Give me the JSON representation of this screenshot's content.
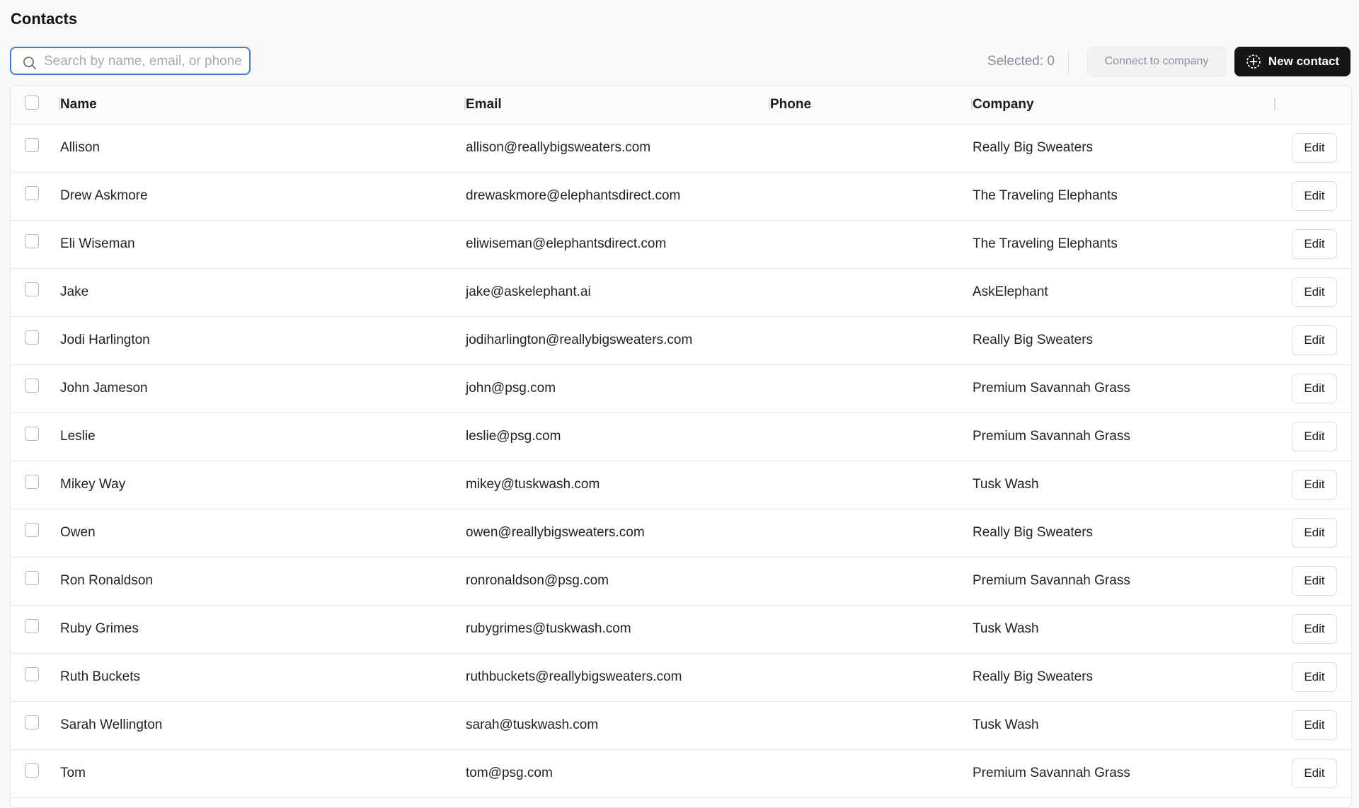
{
  "page": {
    "title": "Contacts"
  },
  "toolbar": {
    "search_placeholder": "Search by name, email, or phone",
    "search_value": "",
    "selected_label": "Selected: 0",
    "connect_label": "Connect to company",
    "new_contact_label": "New contact"
  },
  "table": {
    "columns": {
      "name": "Name",
      "email": "Email",
      "phone": "Phone",
      "company": "Company"
    },
    "rows": [
      {
        "name": "Allison",
        "email": "allison@reallybigsweaters.com",
        "phone": "",
        "company": "Really Big Sweaters",
        "action": "Edit"
      },
      {
        "name": "Drew Askmore",
        "email": "drewaskmore@elephantsdirect.com",
        "phone": "",
        "company": "The Traveling Elephants",
        "action": "Edit"
      },
      {
        "name": "Eli Wiseman",
        "email": "eliwiseman@elephantsdirect.com",
        "phone": "",
        "company": "The Traveling Elephants",
        "action": "Edit"
      },
      {
        "name": "Jake",
        "email": "jake@askelephant.ai",
        "phone": "",
        "company": "AskElephant",
        "action": "Edit"
      },
      {
        "name": "Jodi Harlington",
        "email": "jodiharlington@reallybigsweaters.com",
        "phone": "",
        "company": "Really Big Sweaters",
        "action": "Edit"
      },
      {
        "name": "John Jameson",
        "email": "john@psg.com",
        "phone": "",
        "company": "Premium Savannah Grass",
        "action": "Edit"
      },
      {
        "name": "Leslie",
        "email": "leslie@psg.com",
        "phone": "",
        "company": "Premium Savannah Grass",
        "action": "Edit"
      },
      {
        "name": "Mikey Way",
        "email": "mikey@tuskwash.com",
        "phone": "",
        "company": "Tusk Wash",
        "action": "Edit"
      },
      {
        "name": "Owen",
        "email": "owen@reallybigsweaters.com",
        "phone": "",
        "company": "Really Big Sweaters",
        "action": "Edit"
      },
      {
        "name": "Ron Ronaldson",
        "email": "ronronaldson@psg.com",
        "phone": "",
        "company": "Premium Savannah Grass",
        "action": "Edit"
      },
      {
        "name": "Ruby Grimes",
        "email": "rubygrimes@tuskwash.com",
        "phone": "",
        "company": "Tusk Wash",
        "action": "Edit"
      },
      {
        "name": "Ruth Buckets",
        "email": "ruthbuckets@reallybigsweaters.com",
        "phone": "",
        "company": "Really Big Sweaters",
        "action": "Edit"
      },
      {
        "name": "Sarah Wellington",
        "email": "sarah@tuskwash.com",
        "phone": "",
        "company": "Tusk Wash",
        "action": "Edit"
      },
      {
        "name": "Tom",
        "email": "tom@psg.com",
        "phone": "",
        "company": "Premium Savannah Grass",
        "action": "Edit"
      }
    ]
  },
  "colors": {
    "accent": "#3f7be6",
    "primary_button": "#161616"
  },
  "icons": {
    "search": "search-icon",
    "new_contact": "plus-circle-icon"
  }
}
